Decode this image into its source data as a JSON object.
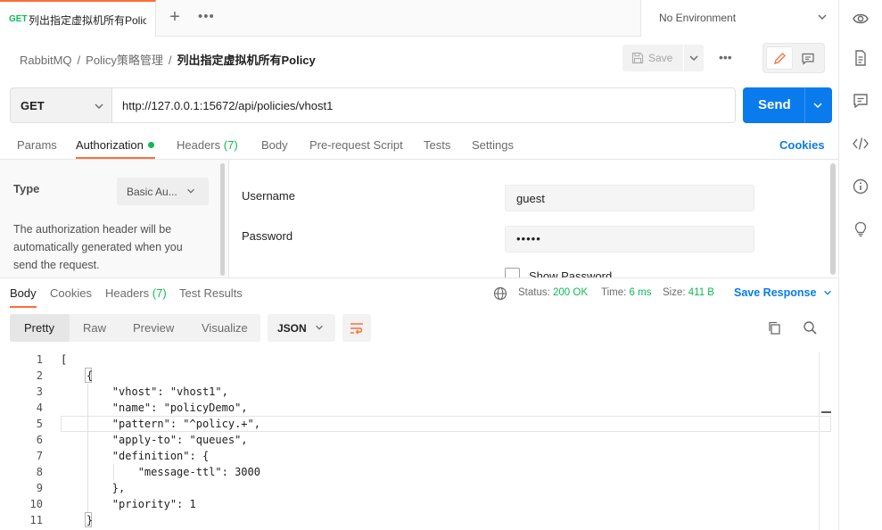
{
  "tab": {
    "method": "GET",
    "title": "列出指定虚拟机所有Policy"
  },
  "environment": {
    "label": "No Environment"
  },
  "breadcrumb": {
    "root": "RabbitMQ",
    "folder": "Policy策略管理",
    "current": "列出指定虚拟机所有Policy",
    "sep": "/"
  },
  "toolbar": {
    "save_label": "Save"
  },
  "request": {
    "method": "GET",
    "url": "http://127.0.0.1:15672/api/policies/vhost1",
    "send_label": "Send"
  },
  "req_tabs": [
    {
      "label": "Params"
    },
    {
      "label": "Authorization"
    },
    {
      "label": "Headers",
      "count": "(7)"
    },
    {
      "label": "Body"
    },
    {
      "label": "Pre-request Script"
    },
    {
      "label": "Tests"
    },
    {
      "label": "Settings"
    }
  ],
  "cookies_label": "Cookies",
  "auth": {
    "type_label": "Type",
    "type_value": "Basic Au...",
    "description": "The authorization header will be automatically generated when you send the request.",
    "username_label": "Username",
    "username_value": "guest",
    "password_label": "Password",
    "password_value": "•••••",
    "show_password_label": "Show Password"
  },
  "response": {
    "tabs": [
      {
        "label": "Body"
      },
      {
        "label": "Cookies"
      },
      {
        "label": "Headers",
        "count": "(7)"
      },
      {
        "label": "Test Results"
      }
    ],
    "status_label": "Status:",
    "status_value": "200 OK",
    "time_label": "Time:",
    "time_value": "6 ms",
    "size_label": "Size:",
    "size_value": "411 B",
    "save_response_label": "Save Response",
    "views": [
      "Pretty",
      "Raw",
      "Preview",
      "Visualize"
    ],
    "format": "JSON"
  },
  "code_lines": [
    {
      "n": "1",
      "text": "["
    },
    {
      "n": "2",
      "text": "    {"
    },
    {
      "n": "3",
      "text": "        \"vhost\": \"vhost1\","
    },
    {
      "n": "4",
      "text": "        \"name\": \"policyDemo\","
    },
    {
      "n": "5",
      "text": "        \"pattern\": \"^policy.+\","
    },
    {
      "n": "6",
      "text": "        \"apply-to\": \"queues\","
    },
    {
      "n": "7",
      "text": "        \"definition\": {"
    },
    {
      "n": "8",
      "text": "            \"message-ttl\": 3000"
    },
    {
      "n": "9",
      "text": "        },"
    },
    {
      "n": "10",
      "text": "        \"priority\": 1"
    },
    {
      "n": "11",
      "text": "    }"
    }
  ],
  "colors": {
    "accent": "#ff6c37",
    "primary": "#097bed",
    "success": "#0cbb52"
  }
}
